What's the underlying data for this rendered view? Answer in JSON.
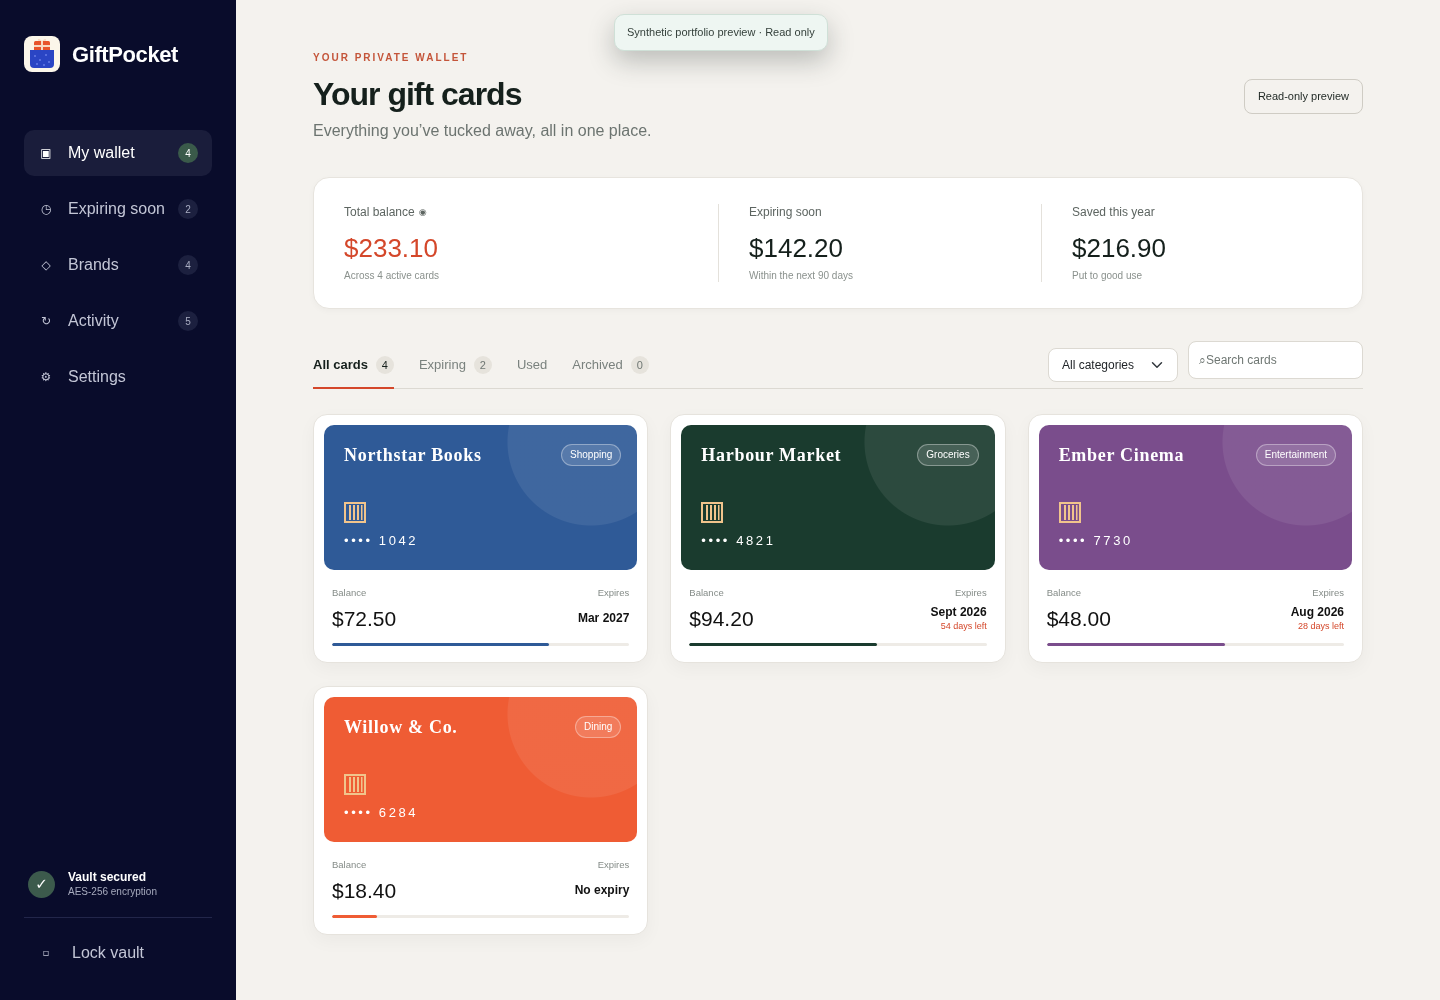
{
  "sidebar": {
    "brand": "GiftPocket",
    "nav": [
      {
        "icon": "▣",
        "label": "My wallet",
        "count": "4",
        "selected": true
      },
      {
        "icon": "◷",
        "label": "Expiring soon",
        "count": "2",
        "selected": false
      },
      {
        "icon": "◇",
        "label": "Brands",
        "count": "4",
        "selected": false
      },
      {
        "icon": "↻",
        "label": "Activity",
        "count": "5",
        "selected": false
      },
      {
        "icon": "⚙",
        "label": "Settings",
        "selected": false
      }
    ],
    "security": {
      "icon": "✓",
      "title": "Vault secured",
      "detail": "AES-256 encryption"
    },
    "lock": {
      "icon": "▫",
      "label": "Lock vault"
    }
  },
  "toast": "Synthetic portfolio preview · Read only",
  "header": {
    "eyebrow": "YOUR PRIVATE WALLET",
    "title": "Your gift cards",
    "subtitle": "Everything you’ve tucked away, all in one place.",
    "action": "Read-only preview"
  },
  "stats": [
    {
      "label": "Total balance",
      "icon": "◉",
      "value": "$233.10",
      "note": "Across 4 active cards",
      "accent": true
    },
    {
      "label": "Expiring soon",
      "value": "$142.20",
      "note": "Within the next 90 days",
      "accent": false
    },
    {
      "label": "Saved this year",
      "value": "$216.90",
      "note": "Put to good use",
      "accent": false
    }
  ],
  "filters": {
    "tabs": [
      {
        "label": "All cards",
        "count": "4",
        "selected": true
      },
      {
        "label": "Expiring",
        "count": "2",
        "selected": false
      },
      {
        "label": "Used",
        "selected": false
      },
      {
        "label": "Archived",
        "count": "0",
        "selected": false
      }
    ],
    "category": "All categories",
    "search": {
      "placeholder": "⌕Search cards"
    }
  },
  "cards": [
    {
      "name": "Northstar Books",
      "category": "Shopping",
      "number": "•••• 1042",
      "color": "#2f5a97",
      "balance_label": "Balance",
      "balance": "$72.50",
      "expires_label": "Expires",
      "expires": "Mar 2027",
      "level": 0.73
    },
    {
      "name": "Harbour Market",
      "category": "Groceries",
      "number": "•••• 4821",
      "color": "#1a3b2e",
      "balance_label": "Balance",
      "balance": "$94.20",
      "expires_label": "Expires",
      "expires": "Sept 2026",
      "days_left": "54 days left",
      "level": 0.63
    },
    {
      "name": "Ember Cinema",
      "category": "Entertainment",
      "number": "•••• 7730",
      "color": "#7a4d8c",
      "balance_label": "Balance",
      "balance": "$48.00",
      "expires_label": "Expires",
      "expires": "Aug 2026",
      "days_left": "28 days left",
      "level": 0.6
    },
    {
      "name": "Willow & Co.",
      "category": "Dining",
      "number": "•••• 6284",
      "color": "#ef5c34",
      "balance_label": "Balance",
      "balance": "$18.40",
      "expires_label": "Expires",
      "expires": "No expiry",
      "level": 0.15
    }
  ]
}
